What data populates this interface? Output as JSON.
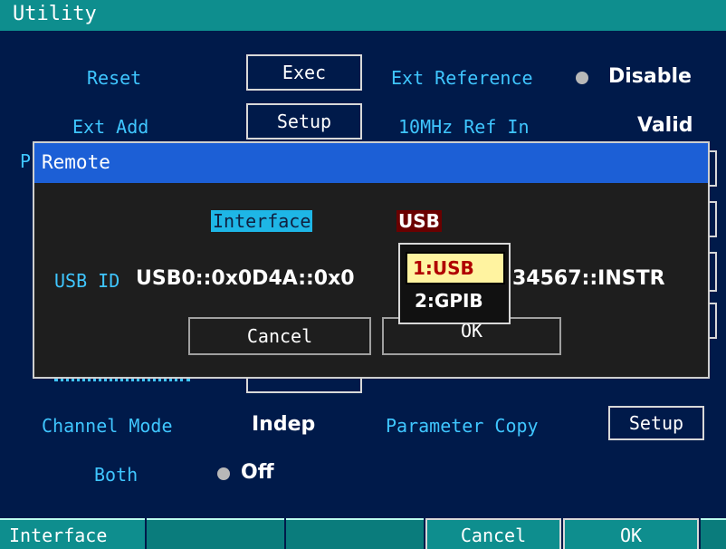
{
  "window": {
    "title": "Utility"
  },
  "main": {
    "reset_label": "Reset",
    "reset_button": "Exec",
    "ext_reference_label": "Ext Reference",
    "ext_reference_value": "Disable",
    "ext_add_label": "Ext Add",
    "ext_add_button": "Setup",
    "ref_in_label": "10MHz Ref In",
    "ref_in_value": "Valid",
    "channel_mode_label": "Channel Mode",
    "channel_mode_value": "Indep",
    "parameter_copy_label": "Parameter Copy",
    "parameter_copy_button": "Setup",
    "both_label": "Both",
    "both_value": "Off",
    "partial_p": "P"
  },
  "dialog": {
    "title": "Remote",
    "interface_label": "Interface",
    "interface_value": "USB",
    "usb_id_label": "USB ID",
    "usb_id_left": "USB0::0x0D4A::0x0",
    "usb_id_right": "34567::INSTR",
    "cancel_label": "Cancel",
    "ok_label": "OK",
    "options": [
      "1:USB",
      "2:GPIB"
    ]
  },
  "softkeys": {
    "k1": "Interface",
    "k2": "",
    "k3": "",
    "k4": "Cancel",
    "k5": "OK"
  },
  "colors": {
    "background": "#001a4a",
    "title_bar": "#0e8e8e",
    "label": "#3fc6ff",
    "dialog_title": "#1c5fd6",
    "highlight": "#1eb6e6",
    "dropdown_value": "#6a0000",
    "selected_option": "#fff3a0"
  }
}
